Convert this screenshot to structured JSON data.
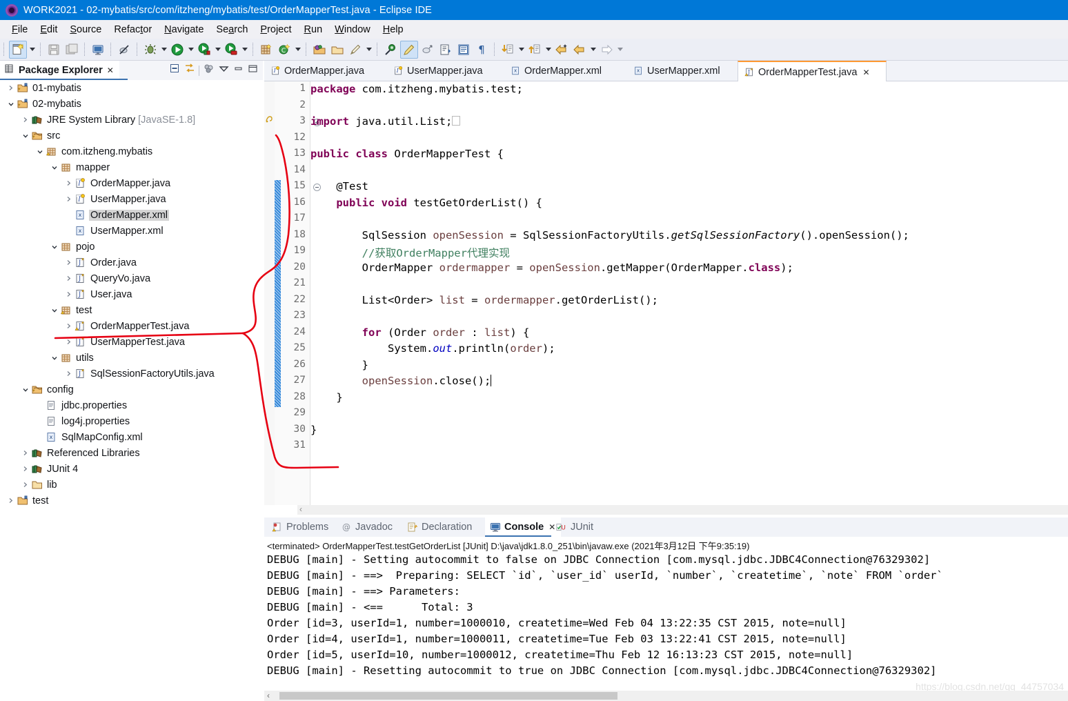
{
  "window": {
    "title": "WORK2021 - 02-mybatis/src/com/itzheng/mybatis/test/OrderMapperTest.java - Eclipse IDE",
    "app_icon": "eclipse-icon",
    "titlebar_color": "#0078d7"
  },
  "menubar": {
    "items": [
      {
        "label": "File",
        "mnemonic": "F"
      },
      {
        "label": "Edit",
        "mnemonic": "E"
      },
      {
        "label": "Source",
        "mnemonic": "S"
      },
      {
        "label": "Refactor",
        "mnemonic": "t"
      },
      {
        "label": "Navigate",
        "mnemonic": "N"
      },
      {
        "label": "Search",
        "mnemonic": "a"
      },
      {
        "label": "Project",
        "mnemonic": "P"
      },
      {
        "label": "Run",
        "mnemonic": "R"
      },
      {
        "label": "Window",
        "mnemonic": "W"
      },
      {
        "label": "Help",
        "mnemonic": "H"
      }
    ]
  },
  "toolbar": {
    "buttons": [
      "new-wizard-icon",
      "new-wizard-dropdown",
      "save-icon",
      "save-all-icon",
      "new-java-console-icon",
      "skip-breakpoints-icon",
      "debug-icon",
      "debug-dropdown",
      "run-icon",
      "run-dropdown",
      "run-server-icon",
      "run-server-dropdown",
      "stop-server-icon",
      "stop-server-dropdown",
      "new-java-package-icon",
      "new-java-class-icon",
      "new-java-class-dropdown",
      "open-type-icon",
      "open-task-icon",
      "annotation-icon",
      "annotation-dropdown",
      "search-icon",
      "toggle-markoccurrences-icon",
      "link-icon",
      "next-annotation-icon",
      "previous-annotation-icon",
      "show-whitespace-icon",
      "next-edit-icon",
      "next-edit-dropdown",
      "previous-edit-icon",
      "previous-edit-dropdown",
      "back-history-icon",
      "forward-history-icon",
      "forward-dropdown",
      "forward-arrow-icon",
      "forward-arrow-dropdown"
    ]
  },
  "package_explorer": {
    "title": "Package Explorer",
    "close_glyph": "✕",
    "view_toolbar": [
      "collapse-all-icon",
      "link-with-editor-icon",
      "view-menu-filters-icon",
      "view-menu-icon",
      "minimize-icon",
      "maximize-icon"
    ],
    "tree": [
      {
        "indent": 0,
        "twisty": "right",
        "icon": "java-project-icon",
        "label": "01-mybatis"
      },
      {
        "indent": 0,
        "twisty": "down",
        "icon": "java-project-icon",
        "label": "02-mybatis"
      },
      {
        "indent": 1,
        "twisty": "right",
        "icon": "library-icon",
        "label": "JRE System Library",
        "suffix": "[JavaSE-1.8]"
      },
      {
        "indent": 1,
        "twisty": "down",
        "icon": "source-folder-icon",
        "label": "src"
      },
      {
        "indent": 2,
        "twisty": "down",
        "icon": "package-warn-icon",
        "label": "com.itzheng.mybatis"
      },
      {
        "indent": 3,
        "twisty": "down",
        "icon": "package-icon",
        "label": "mapper"
      },
      {
        "indent": 4,
        "twisty": "right",
        "icon": "interface-icon",
        "label": "OrderMapper.java"
      },
      {
        "indent": 4,
        "twisty": "right",
        "icon": "interface-icon",
        "label": "UserMapper.java"
      },
      {
        "indent": 4,
        "twisty": "none",
        "icon": "xml-file-icon",
        "label": "OrderMapper.xml",
        "selected": true
      },
      {
        "indent": 4,
        "twisty": "none",
        "icon": "xml-file-icon",
        "label": "UserMapper.xml"
      },
      {
        "indent": 3,
        "twisty": "down",
        "icon": "package-icon",
        "label": "pojo"
      },
      {
        "indent": 4,
        "twisty": "right",
        "icon": "class-icon",
        "label": "Order.java"
      },
      {
        "indent": 4,
        "twisty": "right",
        "icon": "class-icon",
        "label": "QueryVo.java"
      },
      {
        "indent": 4,
        "twisty": "right",
        "icon": "class-icon",
        "label": "User.java"
      },
      {
        "indent": 3,
        "twisty": "down",
        "icon": "package-warn-icon",
        "label": "test"
      },
      {
        "indent": 4,
        "twisty": "right",
        "icon": "class-warn-icon",
        "label": "OrderMapperTest.java"
      },
      {
        "indent": 4,
        "twisty": "right",
        "icon": "class-icon",
        "label": "UserMapperTest.java"
      },
      {
        "indent": 3,
        "twisty": "down",
        "icon": "package-icon",
        "label": "utils"
      },
      {
        "indent": 4,
        "twisty": "right",
        "icon": "class-icon",
        "label": "SqlSessionFactoryUtils.java"
      },
      {
        "indent": 1,
        "twisty": "down",
        "icon": "source-folder-icon",
        "label": "config"
      },
      {
        "indent": 2,
        "twisty": "none",
        "icon": "properties-file-icon",
        "label": "jdbc.properties"
      },
      {
        "indent": 2,
        "twisty": "none",
        "icon": "properties-file-icon",
        "label": "log4j.properties"
      },
      {
        "indent": 2,
        "twisty": "none",
        "icon": "xml-file-icon",
        "label": "SqlMapConfig.xml"
      },
      {
        "indent": 1,
        "twisty": "right",
        "icon": "library-icon",
        "label": "Referenced Libraries"
      },
      {
        "indent": 1,
        "twisty": "right",
        "icon": "library-icon",
        "label": "JUnit 4"
      },
      {
        "indent": 1,
        "twisty": "right",
        "icon": "folder-icon",
        "label": "lib"
      },
      {
        "indent": 0,
        "twisty": "right",
        "icon": "project-icon",
        "label": "test"
      }
    ]
  },
  "editor": {
    "tabs": [
      {
        "label": "OrderMapper.java",
        "icon": "interface-icon",
        "active": false,
        "closeable": false
      },
      {
        "label": "UserMapper.java",
        "icon": "interface-icon",
        "active": false,
        "closeable": false
      },
      {
        "label": "OrderMapper.xml",
        "icon": "xml-file-icon",
        "active": false,
        "closeable": false
      },
      {
        "label": "UserMapper.xml",
        "icon": "xml-file-icon",
        "active": false,
        "closeable": false
      },
      {
        "label": "OrderMapperTest.java",
        "icon": "class-warn-icon",
        "active": true,
        "closeable": true,
        "close_glyph": "✕"
      }
    ],
    "change_bar_start_line": 15,
    "change_bar_end_line": 28,
    "highlighted_line": 27,
    "line_numbers": [
      1,
      2,
      3,
      12,
      13,
      14,
      15,
      16,
      17,
      18,
      19,
      20,
      21,
      22,
      23,
      24,
      25,
      26,
      27,
      28,
      29,
      30,
      31
    ],
    "lines": [
      {
        "n": 1,
        "html": "<span class=\"kw\">package</span> com.itzheng.mybatis.test;"
      },
      {
        "n": 2,
        "html": ""
      },
      {
        "n": 3,
        "html": "<span class=\"kw\">import</span> java.util.List;<span class=\"impbox\"></span>",
        "fold": "plus",
        "marker": "warning-marker"
      },
      {
        "n": 12,
        "html": ""
      },
      {
        "n": 13,
        "html": "<span class=\"kw\">public</span> <span class=\"kw\">class</span> OrderMapperTest {"
      },
      {
        "n": 14,
        "html": ""
      },
      {
        "n": 15,
        "html": "    @Test",
        "fold": "minus"
      },
      {
        "n": 16,
        "html": "    <span class=\"kw\">public</span> <span class=\"kw\">void</span> testGetOrderList() {"
      },
      {
        "n": 17,
        "html": ""
      },
      {
        "n": 18,
        "html": "        SqlSession <span class=\"loc\">openSession</span> = SqlSessionFactoryUtils.<span class=\"mstat\">getSqlSessionFactory</span>().openSession();"
      },
      {
        "n": 19,
        "html": "        <span class=\"cmt\">//获取OrderMapper代理实现</span>"
      },
      {
        "n": 20,
        "html": "        OrderMapper <span class=\"loc\">ordermapper</span> = <span class=\"loc\">openSession</span>.getMapper(OrderMapper.<span class=\"kw\">class</span>);"
      },
      {
        "n": 21,
        "html": ""
      },
      {
        "n": 22,
        "html": "        List&lt;Order&gt; <span class=\"loc\">list</span> = <span class=\"loc\">ordermapper</span>.getOrderList();"
      },
      {
        "n": 23,
        "html": ""
      },
      {
        "n": 24,
        "html": "        <span class=\"kw\">for</span> (Order <span class=\"loc\">order</span> : <span class=\"loc\">list</span>) {"
      },
      {
        "n": 25,
        "html": "            System.<span class=\"stat\">out</span>.println(<span class=\"loc\">order</span>);"
      },
      {
        "n": 26,
        "html": "        }"
      },
      {
        "n": 27,
        "html": "        <span class=\"loc\">openSession</span>.close();<span class=\"caret\"></span>",
        "highlight": true
      },
      {
        "n": 28,
        "html": "    }"
      },
      {
        "n": 29,
        "html": ""
      },
      {
        "n": 30,
        "html": "}"
      },
      {
        "n": 31,
        "html": ""
      }
    ]
  },
  "bottom_panel": {
    "tabs": [
      {
        "label": "Problems",
        "icon": "problems-icon",
        "active": false
      },
      {
        "label": "Javadoc",
        "icon": "javadoc-icon",
        "active": false
      },
      {
        "label": "Declaration",
        "icon": "declaration-icon",
        "active": false
      },
      {
        "label": "Console",
        "icon": "console-icon",
        "active": true,
        "close_glyph": "✕"
      },
      {
        "label": "JUnit",
        "icon": "junit-icon",
        "active": false
      }
    ],
    "console": {
      "terminated_header": "<terminated> OrderMapperTest.testGetOrderList [JUnit] D:\\java\\jdk1.8.0_251\\bin\\javaw.exe (2021年3月12日 下午9:35:19)",
      "lines": [
        "DEBUG [main] - Setting autocommit to false on JDBC Connection [com.mysql.jdbc.JDBC4Connection@76329302]",
        "DEBUG [main] - ==>  Preparing: SELECT `id`, `user_id` userId, `number`, `createtime`, `note` FROM `order`",
        "DEBUG [main] - ==> Parameters: ",
        "DEBUG [main] - <==      Total: 3",
        "Order [id=3, userId=1, number=1000010, createtime=Wed Feb 04 13:22:35 CST 2015, note=null]",
        "Order [id=4, userId=1, number=1000011, createtime=Tue Feb 03 13:22:41 CST 2015, note=null]",
        "Order [id=5, userId=10, number=1000012, createtime=Thu Feb 12 16:13:23 CST 2015, note=null]",
        "DEBUG [main] - Resetting autocommit to true on JDBC Connection [com.mysql.jdbc.JDBC4Connection@76329302]"
      ]
    }
  },
  "watermark": {
    "text": "https://blog.csdn.net/qq_44757034"
  },
  "annotation": {
    "color": "#e60012",
    "description": "hand-drawn red curve linking OrderMapperTest.java in tree to editor"
  }
}
